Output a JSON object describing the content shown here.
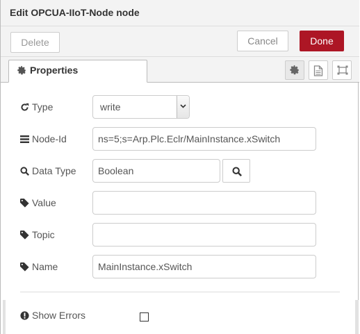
{
  "dialog": {
    "title": "Edit OPCUA-IIoT-Node node"
  },
  "buttons": {
    "delete": "Delete",
    "cancel": "Cancel",
    "done": "Done"
  },
  "tabs": {
    "properties": "Properties"
  },
  "form": {
    "type": {
      "label": "Type",
      "value": "write"
    },
    "node_id": {
      "label": "Node-Id",
      "value": "ns=5;s=Arp.Plc.Eclr/MainInstance.xSwitch"
    },
    "data_type": {
      "label": "Data Type",
      "value": "Boolean"
    },
    "value": {
      "label": "Value",
      "value": ""
    },
    "topic": {
      "label": "Topic",
      "value": ""
    },
    "name": {
      "label": "Name",
      "value": "MainInstance.xSwitch"
    },
    "show_errors": {
      "label": "Show Errors",
      "checked": false
    }
  },
  "colors": {
    "done_button": "#ad1625",
    "header_bg": "#f3f3f3"
  },
  "icons": {
    "type": "refresh-icon",
    "node_id": "list-icon",
    "data_type": "search-icon",
    "value": "tag-icon",
    "topic": "tag-icon",
    "name": "tag-icon",
    "show_errors": "exclamation-circle-icon"
  }
}
